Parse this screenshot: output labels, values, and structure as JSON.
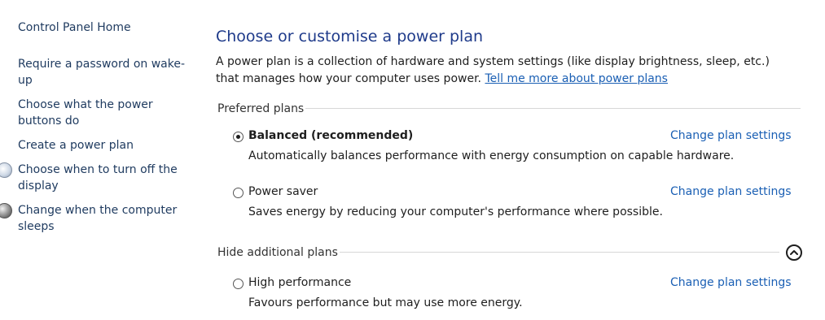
{
  "sidebar": {
    "home": "Control Panel Home",
    "items": [
      {
        "label": "Require a password on wake-up"
      },
      {
        "label": "Choose what the power buttons do"
      },
      {
        "label": "Create a power plan"
      },
      {
        "label": "Choose when to turn off the display",
        "icon": "monitor-icon"
      },
      {
        "label": "Change when the computer sleeps",
        "icon": "moon-icon"
      }
    ]
  },
  "main": {
    "title": "Choose or customise a power plan",
    "description": "A power plan is a collection of hardware and system settings (like display brightness, sleep, etc.) that manages how your computer uses power.",
    "more_link": "Tell me more about power plans",
    "preferred_heading": "Preferred plans",
    "additional_heading": "Hide additional plans",
    "plans": [
      {
        "name": "Balanced (recommended)",
        "selected": true,
        "description": "Automatically balances performance with energy consumption on capable hardware.",
        "change_link": "Change plan settings"
      },
      {
        "name": "Power saver",
        "selected": false,
        "description": "Saves energy by reducing your computer's performance where possible.",
        "change_link": "Change plan settings"
      },
      {
        "name": "High performance",
        "selected": false,
        "description": "Favours performance but may use more energy.",
        "change_link": "Change plan settings"
      }
    ],
    "collapse_icon": "chevron-up-icon"
  }
}
